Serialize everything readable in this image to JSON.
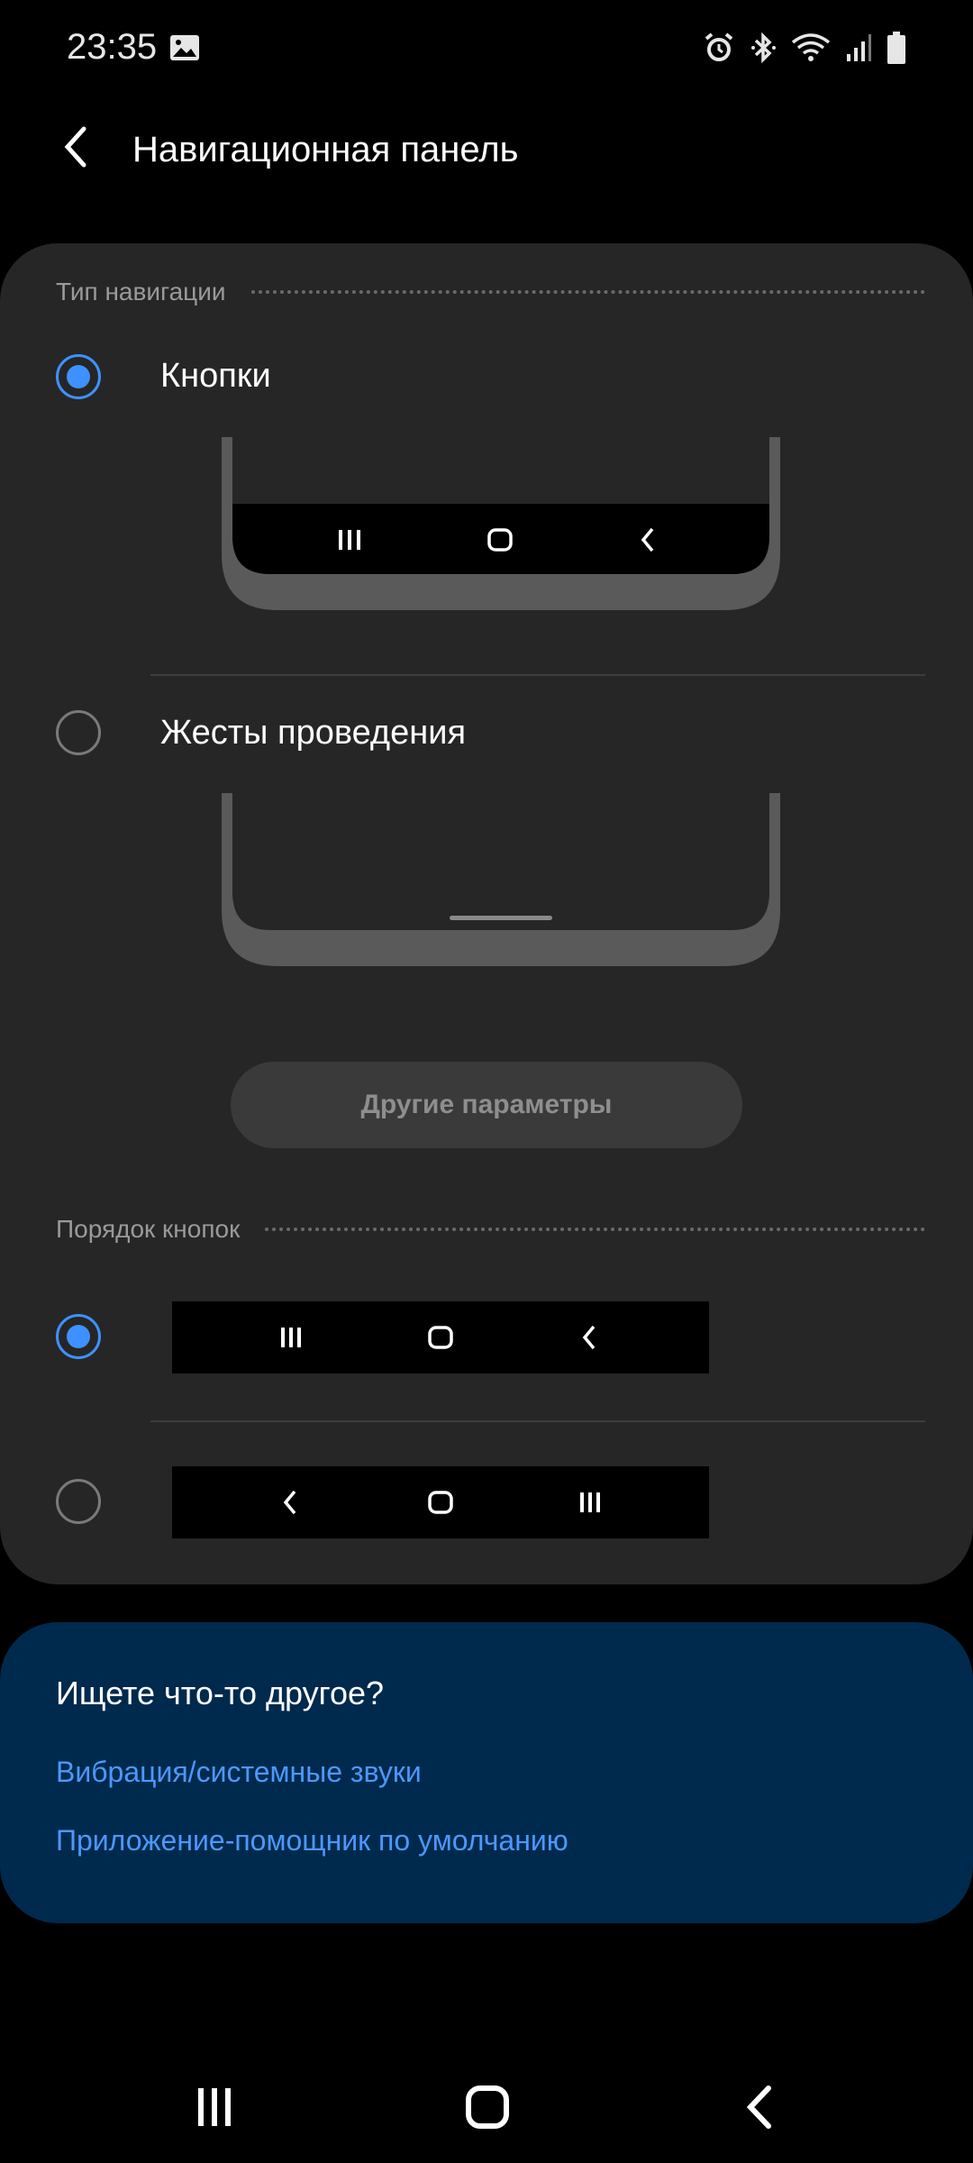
{
  "status_bar": {
    "time": "23:35",
    "left_icons": [
      "image-icon"
    ],
    "right_icons": [
      "alarm-icon",
      "bluetooth-icon",
      "wifi-icon",
      "signal-icon",
      "battery-icon"
    ]
  },
  "header": {
    "title": "Навигационная панель",
    "back_icon": "chevron-left-icon"
  },
  "navigation_type": {
    "section_label": "Тип навигации",
    "options": [
      {
        "label": "Кнопки",
        "selected": true
      },
      {
        "label": "Жесты проведения",
        "selected": false
      }
    ],
    "other_params_label": "Другие параметры"
  },
  "button_order": {
    "section_label": "Порядок кнопок",
    "options": [
      {
        "selected": true,
        "icons": [
          "recents-icon",
          "home-icon",
          "back-icon"
        ]
      },
      {
        "selected": false,
        "icons": [
          "back-icon",
          "home-icon",
          "recents-icon"
        ]
      }
    ]
  },
  "looking_for_more": {
    "title": "Ищете что-то другое?",
    "links": [
      "Вибрация/системные звуки",
      "Приложение-помощник по умолчанию"
    ]
  },
  "system_nav": [
    "recents-icon",
    "home-icon",
    "back-icon"
  ],
  "colors": {
    "accent": "#3e91ff",
    "card_bg": "#262626",
    "more_card_bg": "#002a4d",
    "link": "#4c98ff"
  }
}
